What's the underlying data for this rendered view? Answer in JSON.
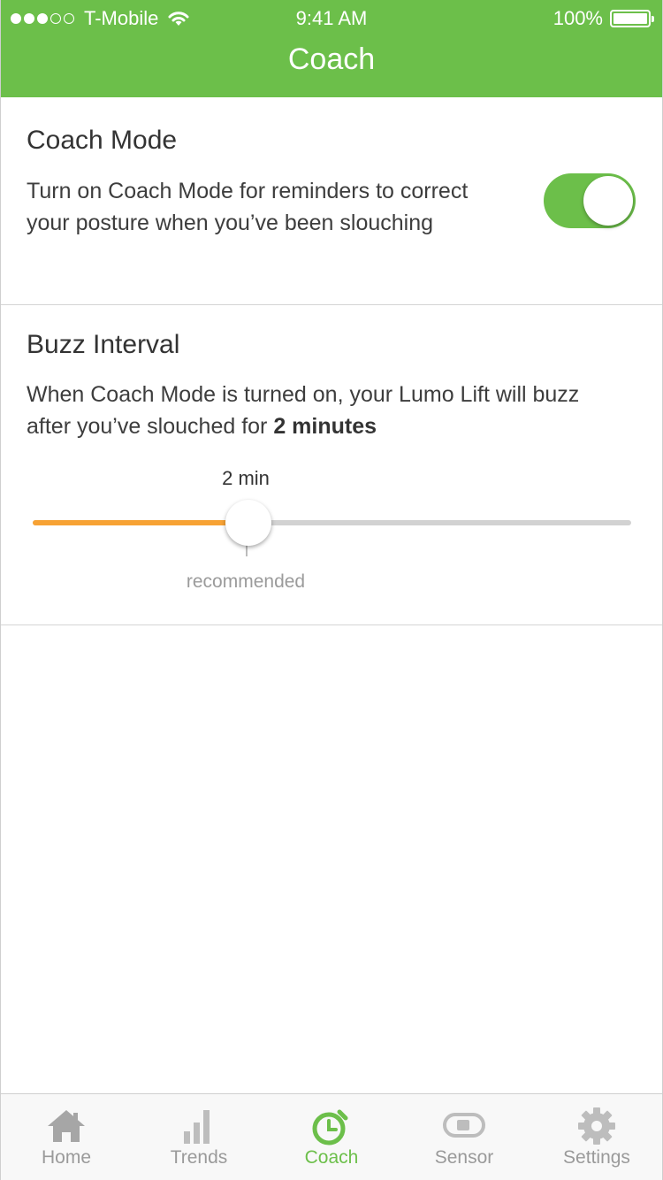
{
  "status_bar": {
    "signal_dots_filled": 3,
    "signal_dots_total": 5,
    "carrier": "T-Mobile",
    "time": "9:41 AM",
    "battery": "100%"
  },
  "nav": {
    "title": "Coach"
  },
  "coach_mode": {
    "heading": "Coach Mode",
    "description": "Turn on Coach Mode for reminders to correct your posture when you’ve been slouching",
    "toggle_on": true
  },
  "buzz_interval": {
    "heading": "Buzz Interval",
    "description_prefix": "When Coach Mode is turned on, your Lumo Lift will buzz after you’ve slouched for ",
    "description_value": "2 minutes",
    "slider_value_label": "2 min",
    "slider_fraction": 0.36,
    "recommended_label": "recommended"
  },
  "tabs": [
    {
      "label": "Home",
      "icon": "home-icon",
      "active": false
    },
    {
      "label": "Trends",
      "icon": "bar-chart-icon",
      "active": false
    },
    {
      "label": "Coach",
      "icon": "stopwatch-icon",
      "active": true
    },
    {
      "label": "Sensor",
      "icon": "sensor-icon",
      "active": false
    },
    {
      "label": "Settings",
      "icon": "gear-icon",
      "active": false
    }
  ],
  "colors": {
    "brand_green": "#6cbf4a",
    "slider_orange": "#f7a234",
    "inactive_gray": "#9a9a9a"
  }
}
